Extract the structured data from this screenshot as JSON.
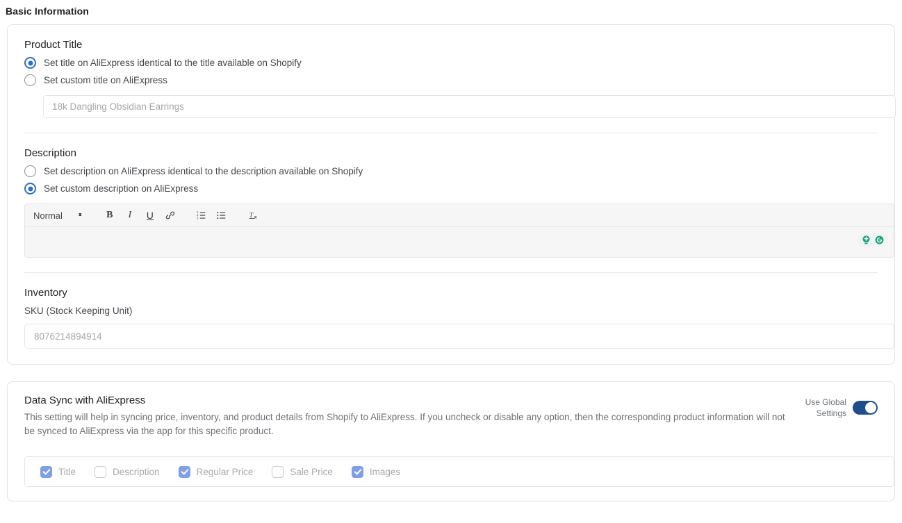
{
  "page": {
    "heading": "Basic Information"
  },
  "product_title": {
    "section_label": "Product Title",
    "options": [
      {
        "label": "Set title on AliExpress identical to the title available on Shopify",
        "selected": true
      },
      {
        "label": "Set custom title on AliExpress",
        "selected": false
      }
    ],
    "input_placeholder": "18k Dangling Obsidian Earrings",
    "input_value": ""
  },
  "description": {
    "section_label": "Description",
    "options": [
      {
        "label": "Set description on AliExpress identical to the description available on Shopify",
        "selected": false
      },
      {
        "label": "Set custom description on AliExpress",
        "selected": true
      }
    ],
    "editor": {
      "format_select_value": "Normal",
      "toolbar": [
        {
          "name": "bold-icon",
          "glyph": "B"
        },
        {
          "name": "italic-icon",
          "glyph": "I"
        },
        {
          "name": "underline-icon",
          "glyph": "U"
        },
        {
          "name": "link-icon",
          "glyph": "ὑ7"
        },
        {
          "name": "ordered-list-icon",
          "glyph": ""
        },
        {
          "name": "bullet-list-icon",
          "glyph": ""
        },
        {
          "name": "clear-formatting-icon",
          "glyph": "Tx"
        }
      ],
      "content": "",
      "assistant_icons": [
        "grammarly-suggestion-icon",
        "grammarly-logo-icon"
      ]
    }
  },
  "inventory": {
    "section_label": "Inventory",
    "sku_label": "SKU (Stock Keeping Unit)",
    "sku_placeholder": "8076214894914",
    "sku_value": ""
  },
  "data_sync": {
    "title": "Data Sync with AliExpress",
    "description": "This setting will help in syncing price, inventory, and product details from Shopify to AliExpress. If you uncheck or disable any option, then the corresponding product information will not be synced to AliExpress via the app for this specific product.",
    "global_settings_label": "Use Global Settings",
    "global_settings_enabled": true,
    "checkboxes": [
      {
        "label": "Title",
        "checked": true
      },
      {
        "label": "Description",
        "checked": false
      },
      {
        "label": "Regular Price",
        "checked": true
      },
      {
        "label": "Sale Price",
        "checked": false
      },
      {
        "label": "Images",
        "checked": true
      }
    ]
  },
  "colors": {
    "radio_selected": "#2c6ecb",
    "checkbox_checked": "#7f9ee8",
    "toggle_on": "#1f4e8c",
    "heading": "#202223",
    "body_text": "#6d7175",
    "border": "#e1e3e5",
    "grammarly_teal": "#15a37f"
  }
}
